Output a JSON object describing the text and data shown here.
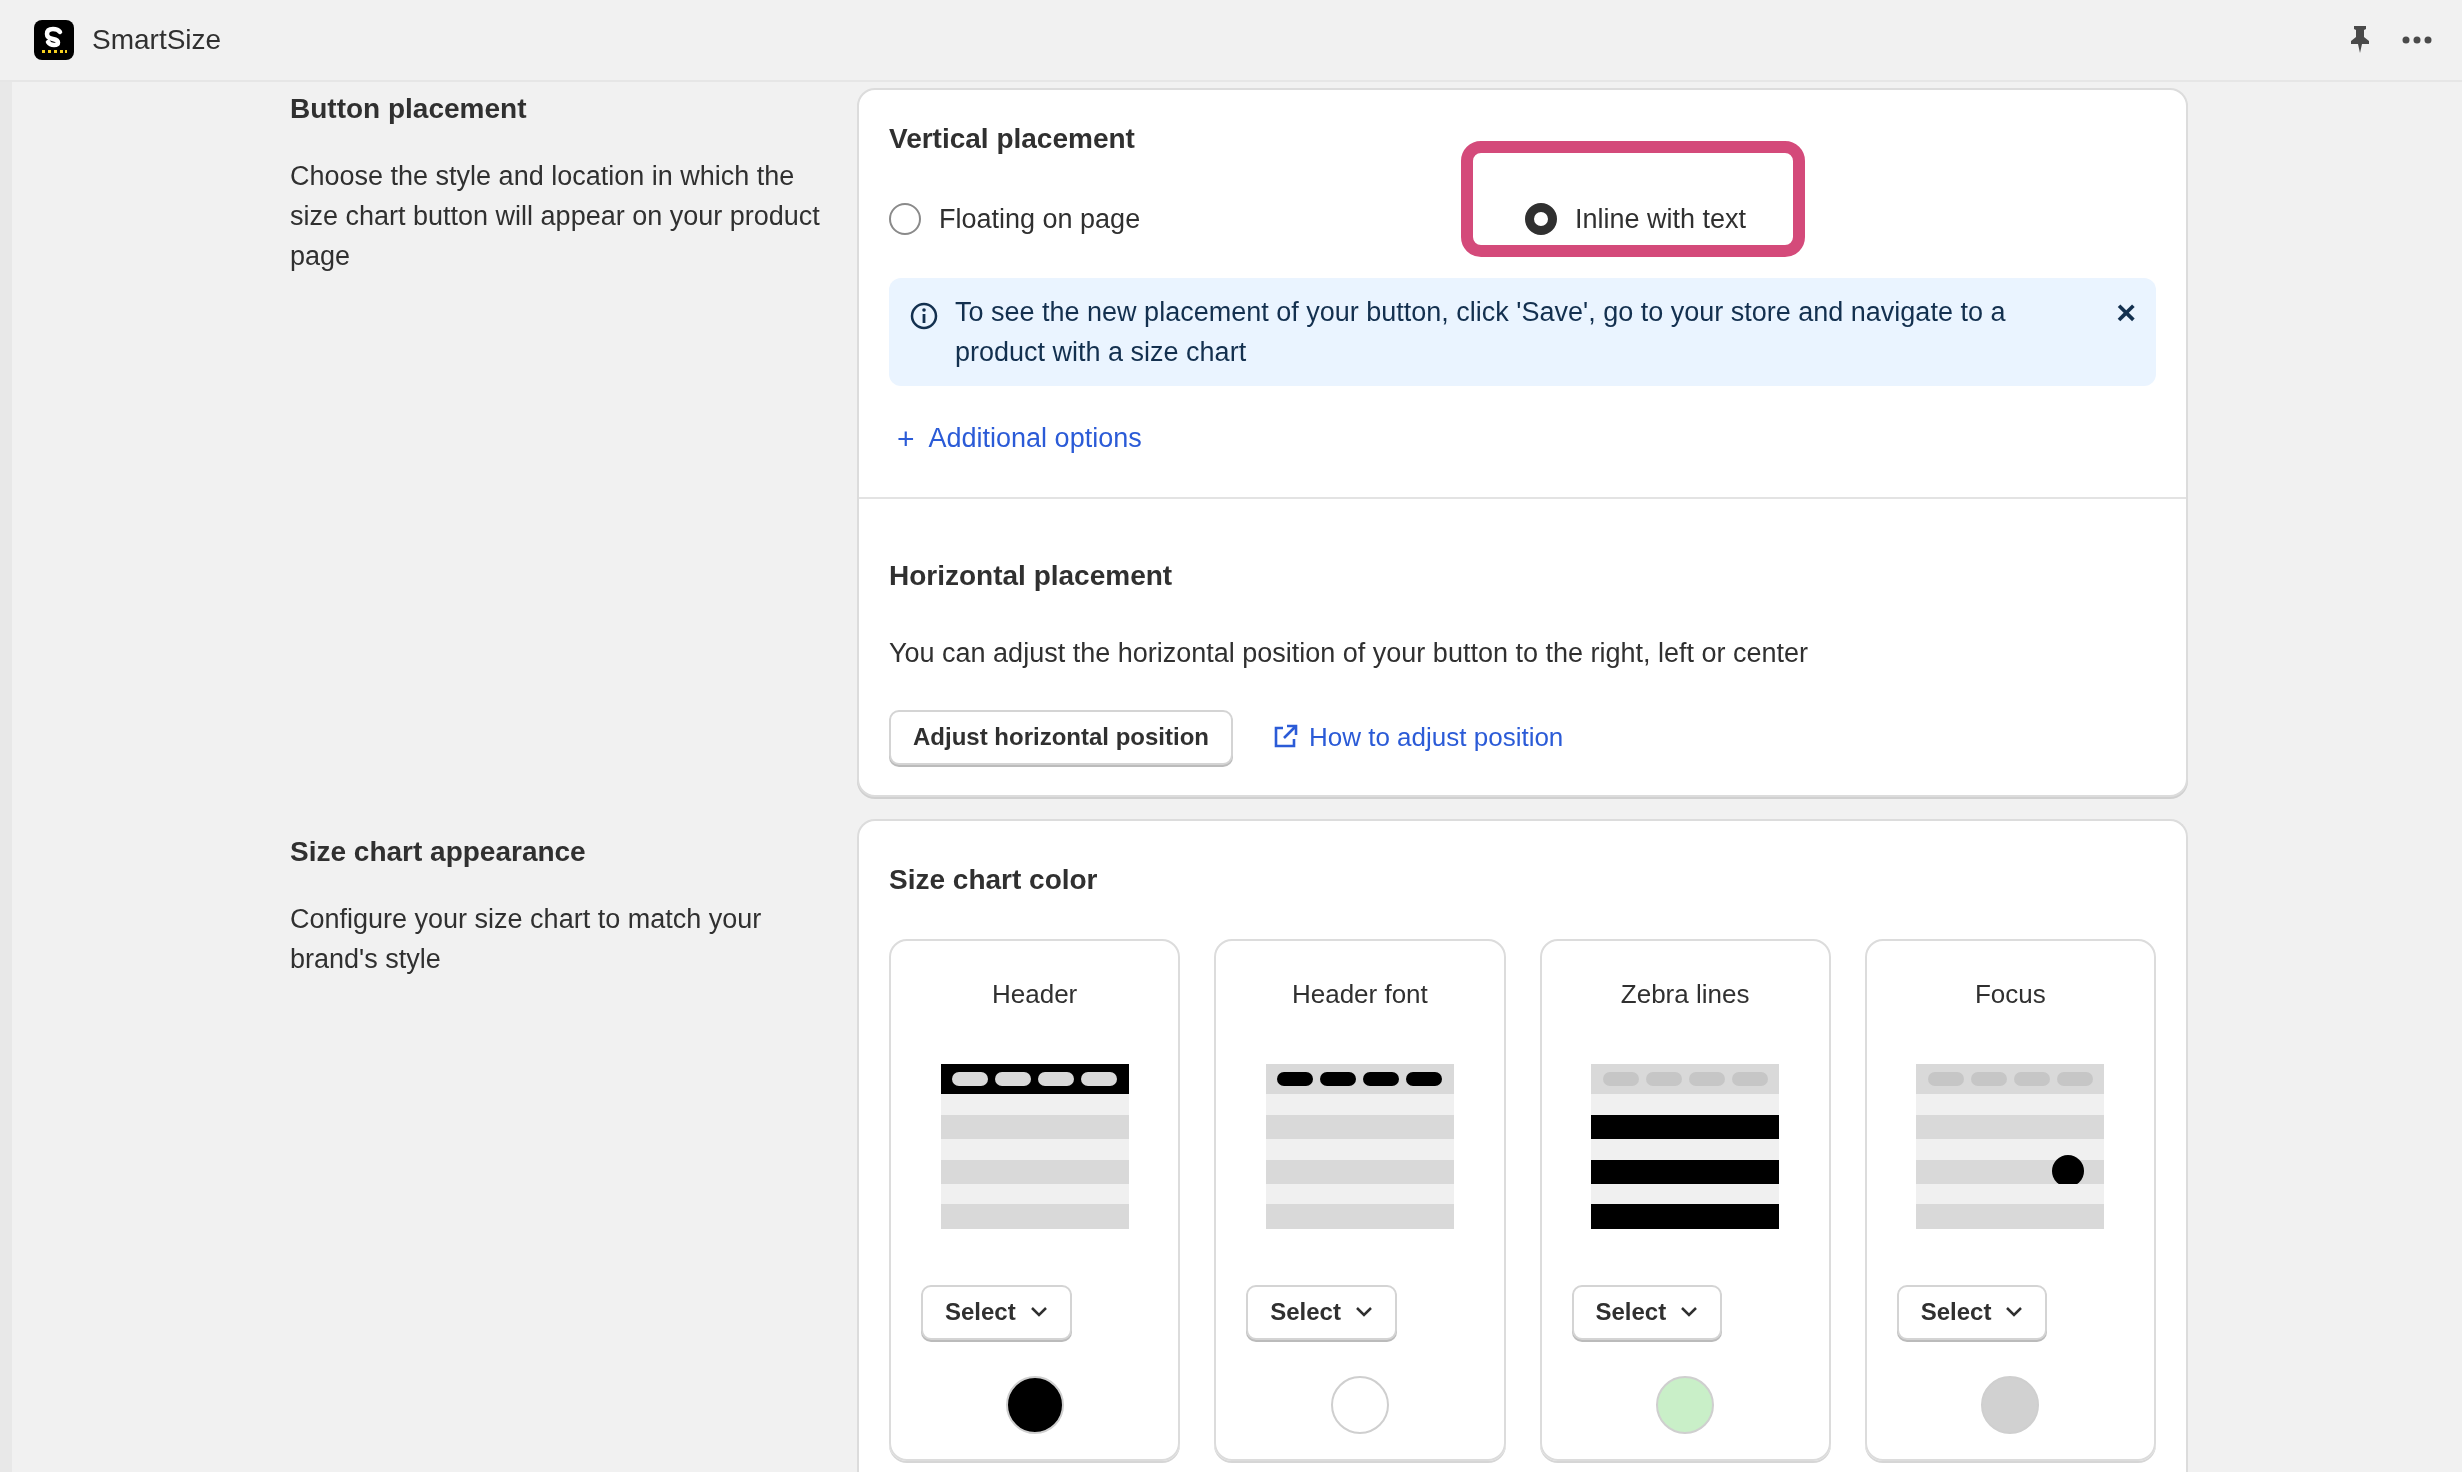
{
  "app": {
    "title": "SmartSize"
  },
  "sections": [
    {
      "kind": "placement",
      "title": "Button placement",
      "description": "Choose the style and location in which the size chart button will appear on your product page",
      "vertical": {
        "title": "Vertical placement",
        "options": [
          {
            "label": "Floating on page",
            "selected": false,
            "highlighted": false
          },
          {
            "label": "Inline with text",
            "selected": true,
            "highlighted": true
          }
        ],
        "notice": "To see the new placement of your button, click 'Save', go to your store and navigate to a product with a size chart",
        "notice_close": "×",
        "more_link": "Additional options",
        "more_icon": "+"
      },
      "horizontal": {
        "title": "Horizontal placement",
        "description": "You can adjust the horizontal position of your button to the right, left or center",
        "button": "Adjust horizontal position",
        "link": "How to adjust position"
      }
    },
    {
      "kind": "appearance",
      "title": "Size chart appearance",
      "description": "Configure your size chart to match your brand's style",
      "color_title": "Size chart color",
      "swatches": [
        {
          "kind": "header",
          "label": "Header",
          "button": "Select",
          "color": "#000000"
        },
        {
          "kind": "header_font",
          "label": "Header font",
          "button": "Select",
          "color": "#ffffff"
        },
        {
          "kind": "zebra",
          "label": "Zebra lines",
          "button": "Select",
          "color": "#c9efc8"
        },
        {
          "kind": "focus",
          "label": "Focus",
          "button": "Select",
          "color": "#d1d1d1"
        }
      ]
    }
  ]
}
